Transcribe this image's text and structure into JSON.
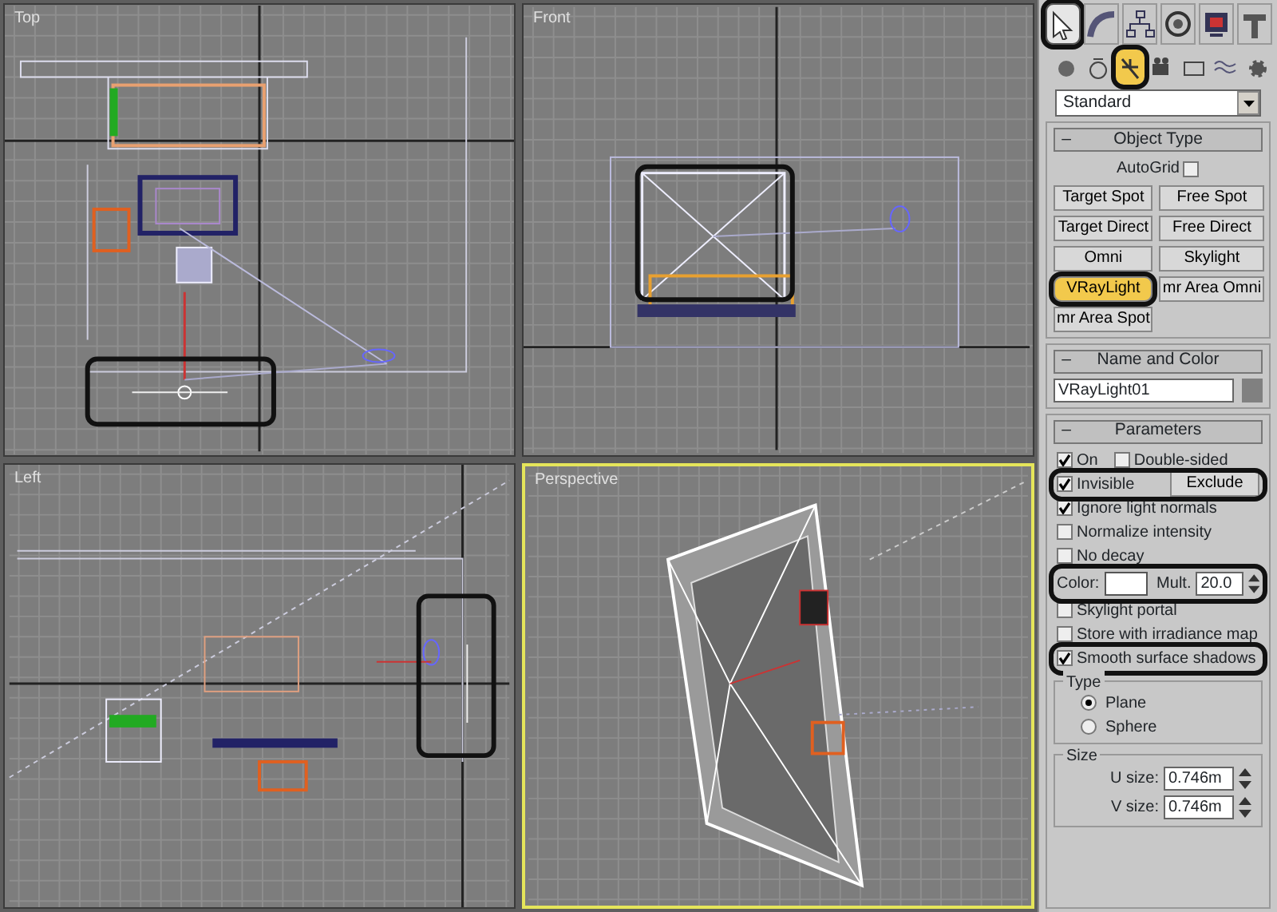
{
  "viewports": [
    {
      "label": "Top",
      "active": false
    },
    {
      "label": "Front",
      "active": false
    },
    {
      "label": "Left",
      "active": false
    },
    {
      "label": "Perspective",
      "active": true
    }
  ],
  "command_panel": {
    "tabs": [
      {
        "kind": "cursor",
        "selected": true,
        "highlighted": true
      },
      {
        "kind": "curve",
        "selected": false,
        "highlighted": false
      },
      {
        "kind": "hierarchy",
        "selected": false,
        "highlighted": false
      },
      {
        "kind": "wheel",
        "selected": false,
        "highlighted": false
      },
      {
        "kind": "monitor",
        "selected": false,
        "highlighted": false
      },
      {
        "kind": "hammer",
        "selected": false,
        "highlighted": false
      }
    ],
    "sub_tabs": [
      {
        "kind": "sphere",
        "selected": false,
        "highlighted": false
      },
      {
        "kind": "shapes",
        "selected": false,
        "highlighted": false
      },
      {
        "kind": "light",
        "selected": true,
        "highlighted": true
      },
      {
        "kind": "camera",
        "selected": false,
        "highlighted": false
      },
      {
        "kind": "helper",
        "selected": false,
        "highlighted": false
      },
      {
        "kind": "wave",
        "selected": false,
        "highlighted": false
      },
      {
        "kind": "gear",
        "selected": false,
        "highlighted": false
      }
    ],
    "category_dropdown": {
      "value": "Standard"
    },
    "object_type": {
      "collapse": "–",
      "title": "Object Type",
      "autogrid": {
        "label": "AutoGrid",
        "checked": false
      },
      "buttons": [
        {
          "label": "Target Spot",
          "selected": false,
          "highlighted": false
        },
        {
          "label": "Free Spot",
          "selected": false,
          "highlighted": false
        },
        {
          "label": "Target Direct",
          "selected": false,
          "highlighted": false
        },
        {
          "label": "Free Direct",
          "selected": false,
          "highlighted": false
        },
        {
          "label": "Omni",
          "selected": false,
          "highlighted": false
        },
        {
          "label": "Skylight",
          "selected": false,
          "highlighted": false
        },
        {
          "label": "VRayLight",
          "selected": true,
          "highlighted": true
        },
        {
          "label": "mr Area Omni",
          "selected": false,
          "highlighted": false
        },
        {
          "label": "mr Area Spot",
          "selected": false,
          "highlighted": false
        }
      ]
    },
    "name_and_color": {
      "collapse": "–",
      "title": "Name and Color",
      "name": "VRayLight01",
      "color": "#808080"
    },
    "parameters": {
      "collapse": "–",
      "title": "Parameters",
      "rows": [
        {
          "kind": "checks",
          "highlighted": false,
          "items": [
            {
              "label": "On",
              "checked": true
            },
            {
              "label": "Double-sided",
              "checked": false
            }
          ]
        },
        {
          "kind": "check_button",
          "highlighted": true,
          "items": [
            {
              "label": "Invisible",
              "checked": true
            }
          ],
          "button": "Exclude"
        },
        {
          "kind": "checks",
          "highlighted": false,
          "items": [
            {
              "label": "Ignore light normals",
              "checked": true
            }
          ]
        },
        {
          "kind": "checks",
          "highlighted": false,
          "items": [
            {
              "label": "Normalize intensity",
              "checked": false
            }
          ]
        },
        {
          "kind": "checks",
          "highlighted": false,
          "items": [
            {
              "label": "No decay",
              "checked": false
            }
          ]
        },
        {
          "kind": "color_mult",
          "highlighted": true,
          "color_label": "Color:",
          "color": "#ffffff",
          "mult_label": "Mult.",
          "mult": "20.0"
        },
        {
          "kind": "checks",
          "highlighted": false,
          "items": [
            {
              "label": "Skylight portal",
              "checked": false
            }
          ]
        },
        {
          "kind": "checks",
          "highlighted": false,
          "items": [
            {
              "label": "Store with irradiance map",
              "checked": false
            }
          ]
        },
        {
          "kind": "checks",
          "highlighted": true,
          "items": [
            {
              "label": "Smooth surface shadows",
              "checked": true
            }
          ]
        }
      ],
      "type_group": {
        "title": "Type",
        "options": [
          {
            "label": "Plane",
            "selected": true
          },
          {
            "label": "Sphere",
            "selected": false
          }
        ]
      },
      "size_group": {
        "title": "Size",
        "fields": [
          {
            "label": "U size:",
            "value": "0.746m"
          },
          {
            "label": "V size:",
            "value": "0.746m"
          }
        ]
      }
    }
  }
}
